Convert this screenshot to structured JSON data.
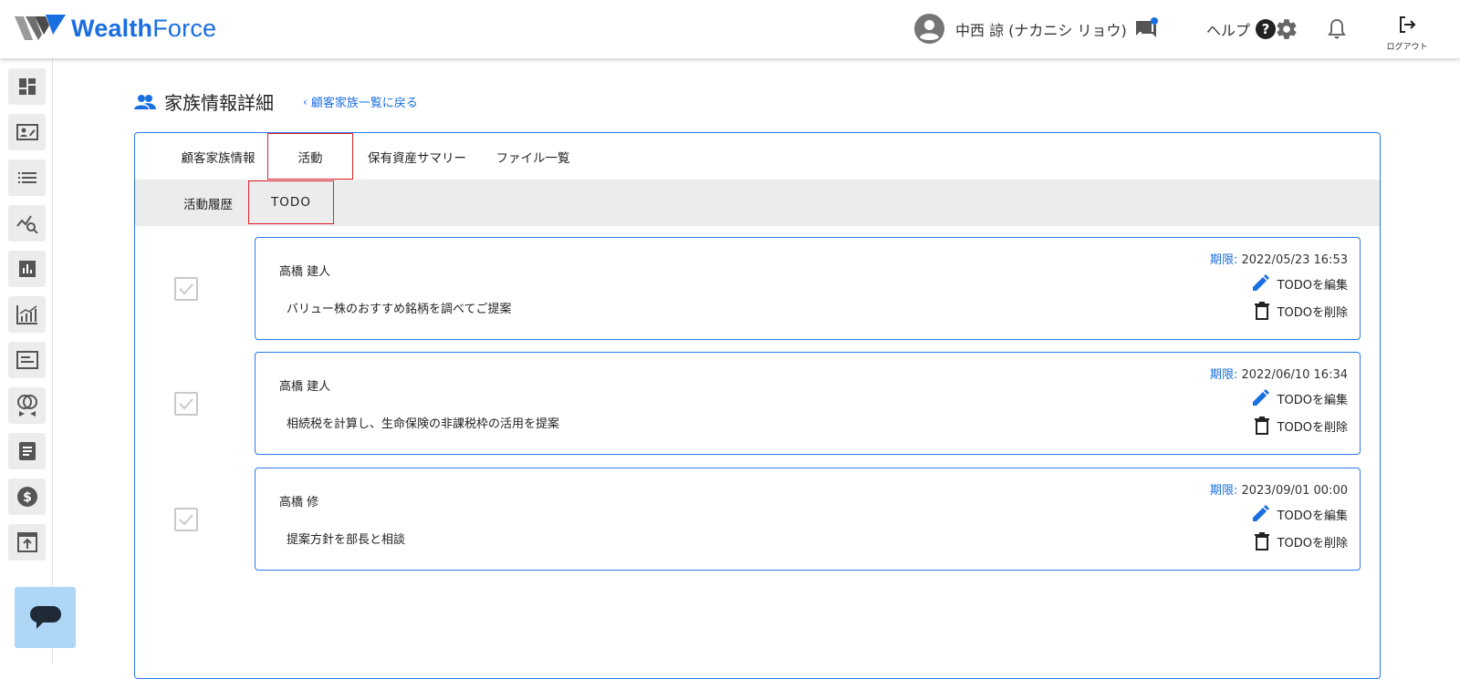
{
  "app": {
    "logo_bold": "Wealth",
    "logo_light": "Force"
  },
  "header": {
    "username": "中西 諒 (ナカニシ リョウ)",
    "help_label": "ヘルプ",
    "help_icon": "?",
    "logout_label": "ログアウト"
  },
  "colors": {
    "accent": "#1a6fe0",
    "highlight_box": "#e0202a",
    "subtab_bg": "#ececec",
    "chat_fab": "#aed6f6"
  },
  "sidebar": {
    "icons": [
      "dashboard-icon",
      "contact-card-icon",
      "list-icon",
      "analytics-icon",
      "bar-chart-icon",
      "growth-chart-icon",
      "article-icon",
      "rings-icon",
      "document-icon",
      "dollar-icon",
      "upload-icon"
    ]
  },
  "page": {
    "title": "家族情報詳細",
    "back_link": "顧客家族一覧に戻る"
  },
  "tabs": [
    "顧客家族情報",
    "活動",
    "保有資産サマリー",
    "ファイル一覧"
  ],
  "active_tab": "活動",
  "subtabs": [
    "活動履歴",
    "TODO"
  ],
  "active_subtab": "TODO",
  "todos": [
    {
      "person": "高橋 建人",
      "description": "バリュー株のおすすめ銘柄を調べてご提案",
      "deadline_label": "期限:",
      "deadline": " 2022/05/23 16:53",
      "edit_label": "TODOを編集",
      "delete_label": "TODOを削除"
    },
    {
      "person": "高橋 建人",
      "description": "相続税を計算し、生命保険の非課税枠の活用を提案",
      "deadline_label": "期限:",
      "deadline": " 2022/06/10 16:34",
      "edit_label": "TODOを編集",
      "delete_label": "TODOを削除"
    },
    {
      "person": "高橋 修",
      "description": "提案方針を部長と相談",
      "deadline_label": "期限:",
      "deadline": " 2023/09/01 00:00",
      "edit_label": "TODOを編集",
      "delete_label": "TODOを削除"
    }
  ]
}
